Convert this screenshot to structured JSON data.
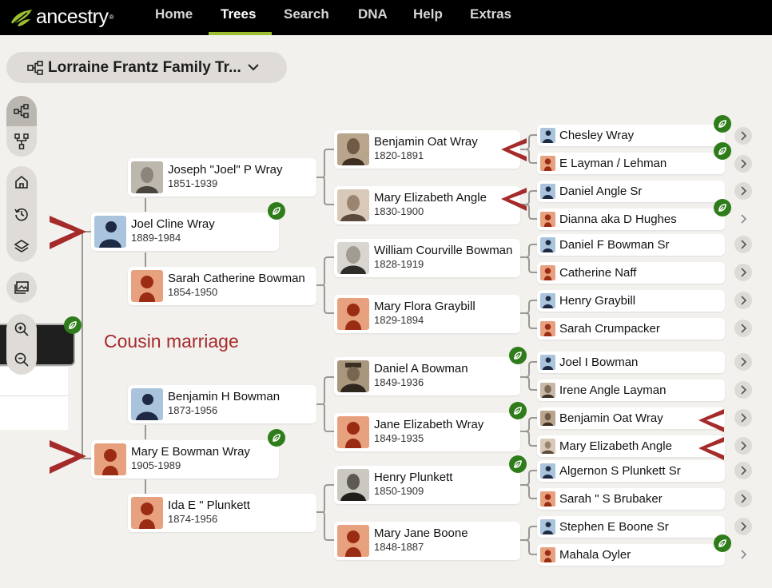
{
  "brand": {
    "logo_text": "ancestry",
    "trademark": "®",
    "accent": "#9cbe30"
  },
  "nav": {
    "items": [
      {
        "label": "Home",
        "active": false
      },
      {
        "label": "Trees",
        "active": true
      },
      {
        "label": "Search",
        "active": false
      },
      {
        "label": "DNA",
        "active": false
      },
      {
        "label": "Help",
        "active": false
      },
      {
        "label": "Extras",
        "active": false
      }
    ]
  },
  "tree_selector": {
    "title": "Lorraine Frantz Family Tr...",
    "icon": "tree-icon",
    "chevron": "chevron-down-icon"
  },
  "toolbar": {
    "tools": [
      "pedigree-view-icon",
      "family-view-icon",
      "home-icon",
      "history-icon",
      "layers-icon",
      "media-icon",
      "zoom-in-icon",
      "zoom-out-icon"
    ]
  },
  "annotation": {
    "label": "Cousin marriage",
    "color": "#a52a2a"
  },
  "colors": {
    "hint_green": "#2f7d1a",
    "female_bg": "#e8a17f",
    "male_bg": "#a9c4dc"
  },
  "people": [
    {
      "id": "joel",
      "name": "Joel Cline Wray",
      "dates": "1889-1984",
      "gender": "male",
      "hint": true
    },
    {
      "id": "mary_e",
      "name": "Mary E Bowman Wray",
      "dates": "1905-1989",
      "gender": "female",
      "hint": true
    },
    {
      "id": "joseph",
      "name": "Joseph \"Joel\" P Wray",
      "dates": "1851-1939",
      "gender": "male",
      "photo": true
    },
    {
      "id": "sarah_c",
      "name": "Sarah Catherine Bowman",
      "dates": "1854-1950",
      "gender": "female"
    },
    {
      "id": "benjamin_h",
      "name": "Benjamin H Bowman",
      "dates": "1873-1956",
      "gender": "male"
    },
    {
      "id": "ida",
      "name": "Ida E \" Plunkett",
      "dates": "1874-1956",
      "gender": "female"
    },
    {
      "id": "benjamin_o",
      "name": "Benjamin Oat Wray",
      "dates": "1820-1891",
      "gender": "male",
      "photo": true
    },
    {
      "id": "mary_eliz",
      "name": "Mary Elizabeth Angle",
      "dates": "1830-1900",
      "gender": "female",
      "photo": true
    },
    {
      "id": "william",
      "name": "William Courville Bowman",
      "dates": "1828-1919",
      "gender": "male",
      "photo": true
    },
    {
      "id": "mary_flora",
      "name": "Mary Flora Graybill",
      "dates": "1829-1894",
      "gender": "female"
    },
    {
      "id": "daniel_a",
      "name": "Daniel A Bowman",
      "dates": "1849-1936",
      "gender": "male",
      "photo": true,
      "hint": true
    },
    {
      "id": "jane",
      "name": "Jane Elizabeth Wray",
      "dates": "1849-1935",
      "gender": "female",
      "hint": true
    },
    {
      "id": "henry_p",
      "name": "Henry Plunkett",
      "dates": "1850-1909",
      "gender": "male",
      "photo": true,
      "hint": true
    },
    {
      "id": "mary_jane",
      "name": "Mary Jane Boone",
      "dates": "1848-1887",
      "gender": "female"
    }
  ],
  "ancestors": [
    {
      "name": "Chesley Wray",
      "gender": "male",
      "hint": true
    },
    {
      "name": "E Layman / Lehman",
      "gender": "female",
      "hint": true
    },
    {
      "name": "Daniel Angle Sr",
      "gender": "male"
    },
    {
      "name": "Dianna aka D Hughes",
      "gender": "female",
      "hint": true
    },
    {
      "name": "Daniel F Bowman Sr",
      "gender": "male"
    },
    {
      "name": "Catherine Naff",
      "gender": "female"
    },
    {
      "name": "Henry Graybill",
      "gender": "male"
    },
    {
      "name": "Sarah Crumpacker",
      "gender": "female"
    },
    {
      "name": "Joel I Bowman",
      "gender": "male"
    },
    {
      "name": "Irene Angle Layman",
      "gender": "female",
      "photo": true
    },
    {
      "name": "Benjamin Oat Wray",
      "gender": "male",
      "photo": true
    },
    {
      "name": "Mary Elizabeth Angle",
      "gender": "female",
      "photo": true
    },
    {
      "name": "Algernon S Plunkett Sr",
      "gender": "male"
    },
    {
      "name": "Sarah \" S Brubaker",
      "gender": "female"
    },
    {
      "name": "Stephen E Boone Sr",
      "gender": "male"
    },
    {
      "name": "Mahala Oyler",
      "gender": "female",
      "hint": true
    }
  ]
}
